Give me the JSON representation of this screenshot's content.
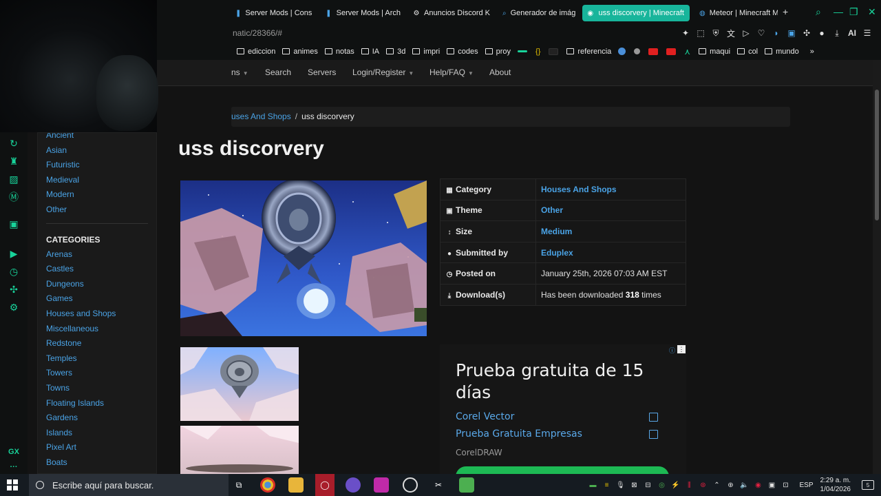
{
  "browser": {
    "tabs": [
      {
        "label": "Server Mods | Cons",
        "icon": "pin-icon",
        "color": "#4aa3e6"
      },
      {
        "label": "Server Mods | Arch",
        "icon": "pin-icon",
        "color": "#4aa3e6"
      },
      {
        "label": "Anuncios Discord K",
        "icon": "gear-icon",
        "color": "#e0e0e0"
      },
      {
        "label": "Generador de imág",
        "icon": "search-icon",
        "color": "#4aa3e6"
      },
      {
        "label": "uss discorvery | Minecraft",
        "icon": "planet-icon",
        "color": "#ffffff",
        "active": true
      },
      {
        "label": "Meteor | Minecraft M",
        "icon": "globe-icon",
        "color": "#4aa3e6"
      }
    ],
    "url": "natic/28366/#",
    "ai_label": "AI",
    "accent": "#18d39a",
    "bookmarks": [
      {
        "label": "ediccion"
      },
      {
        "label": "animes"
      },
      {
        "label": "notas"
      },
      {
        "label": "IA"
      },
      {
        "label": "3d"
      },
      {
        "label": "impri"
      },
      {
        "label": "codes"
      },
      {
        "label": "proy"
      },
      {
        "label": "referencia"
      },
      {
        "label": "maqui"
      },
      {
        "label": "col"
      },
      {
        "label": "mundo"
      }
    ]
  },
  "nav": {
    "items": [
      "Search",
      "Servers",
      "Login/Register",
      "Help/FAQ",
      "About"
    ],
    "partial": "ns"
  },
  "breadcrumb": {
    "parent": "uses And Shops",
    "current": "uss discorvery"
  },
  "sidebar": {
    "themes": [
      "Ancient",
      "Asian",
      "Futuristic",
      "Medieval",
      "Modern",
      "Other"
    ],
    "categories_heading": "CATEGORIES",
    "categories": [
      "Arenas",
      "Castles",
      "Dungeons",
      "Games",
      "Houses and Shops",
      "Miscellaneous",
      "Redstone",
      "Temples",
      "Towers",
      "Towns",
      "Floating Islands",
      "Gardens",
      "Islands",
      "Pixel Art",
      "Boats"
    ]
  },
  "project": {
    "title": "uss discorvery",
    "details": [
      {
        "label": "Category",
        "icon": "grid-icon",
        "value": "Houses And Shops",
        "link": true
      },
      {
        "label": "Theme",
        "icon": "image-icon",
        "value": "Other",
        "link": true
      },
      {
        "label": "Size",
        "icon": "arrows-vertical-icon",
        "value": "Medium",
        "link": true
      },
      {
        "label": "Submitted by",
        "icon": "user-icon",
        "value": "Eduplex",
        "link": true
      },
      {
        "label": "Posted on",
        "icon": "clock-icon",
        "value": "January 25th, 2026 07:03 AM EST",
        "link": false
      },
      {
        "label": "Download(s)",
        "icon": "download-icon",
        "value_prefix": "Has been downloaded ",
        "value_count": "318",
        "value_suffix": " times",
        "link": false
      }
    ]
  },
  "ad": {
    "title": "Prueba gratuita de 15 días",
    "links": [
      "Corel Vector",
      "Prueba Gratuita Empresas"
    ],
    "brand": "CorelDRAW",
    "button_color": "#1db954"
  },
  "taskbar": {
    "search_placeholder": "Escribe aquí para buscar.",
    "language": "ESP",
    "time": "2:29 a. m.",
    "date": "1/04/2026",
    "notifications": "5"
  }
}
